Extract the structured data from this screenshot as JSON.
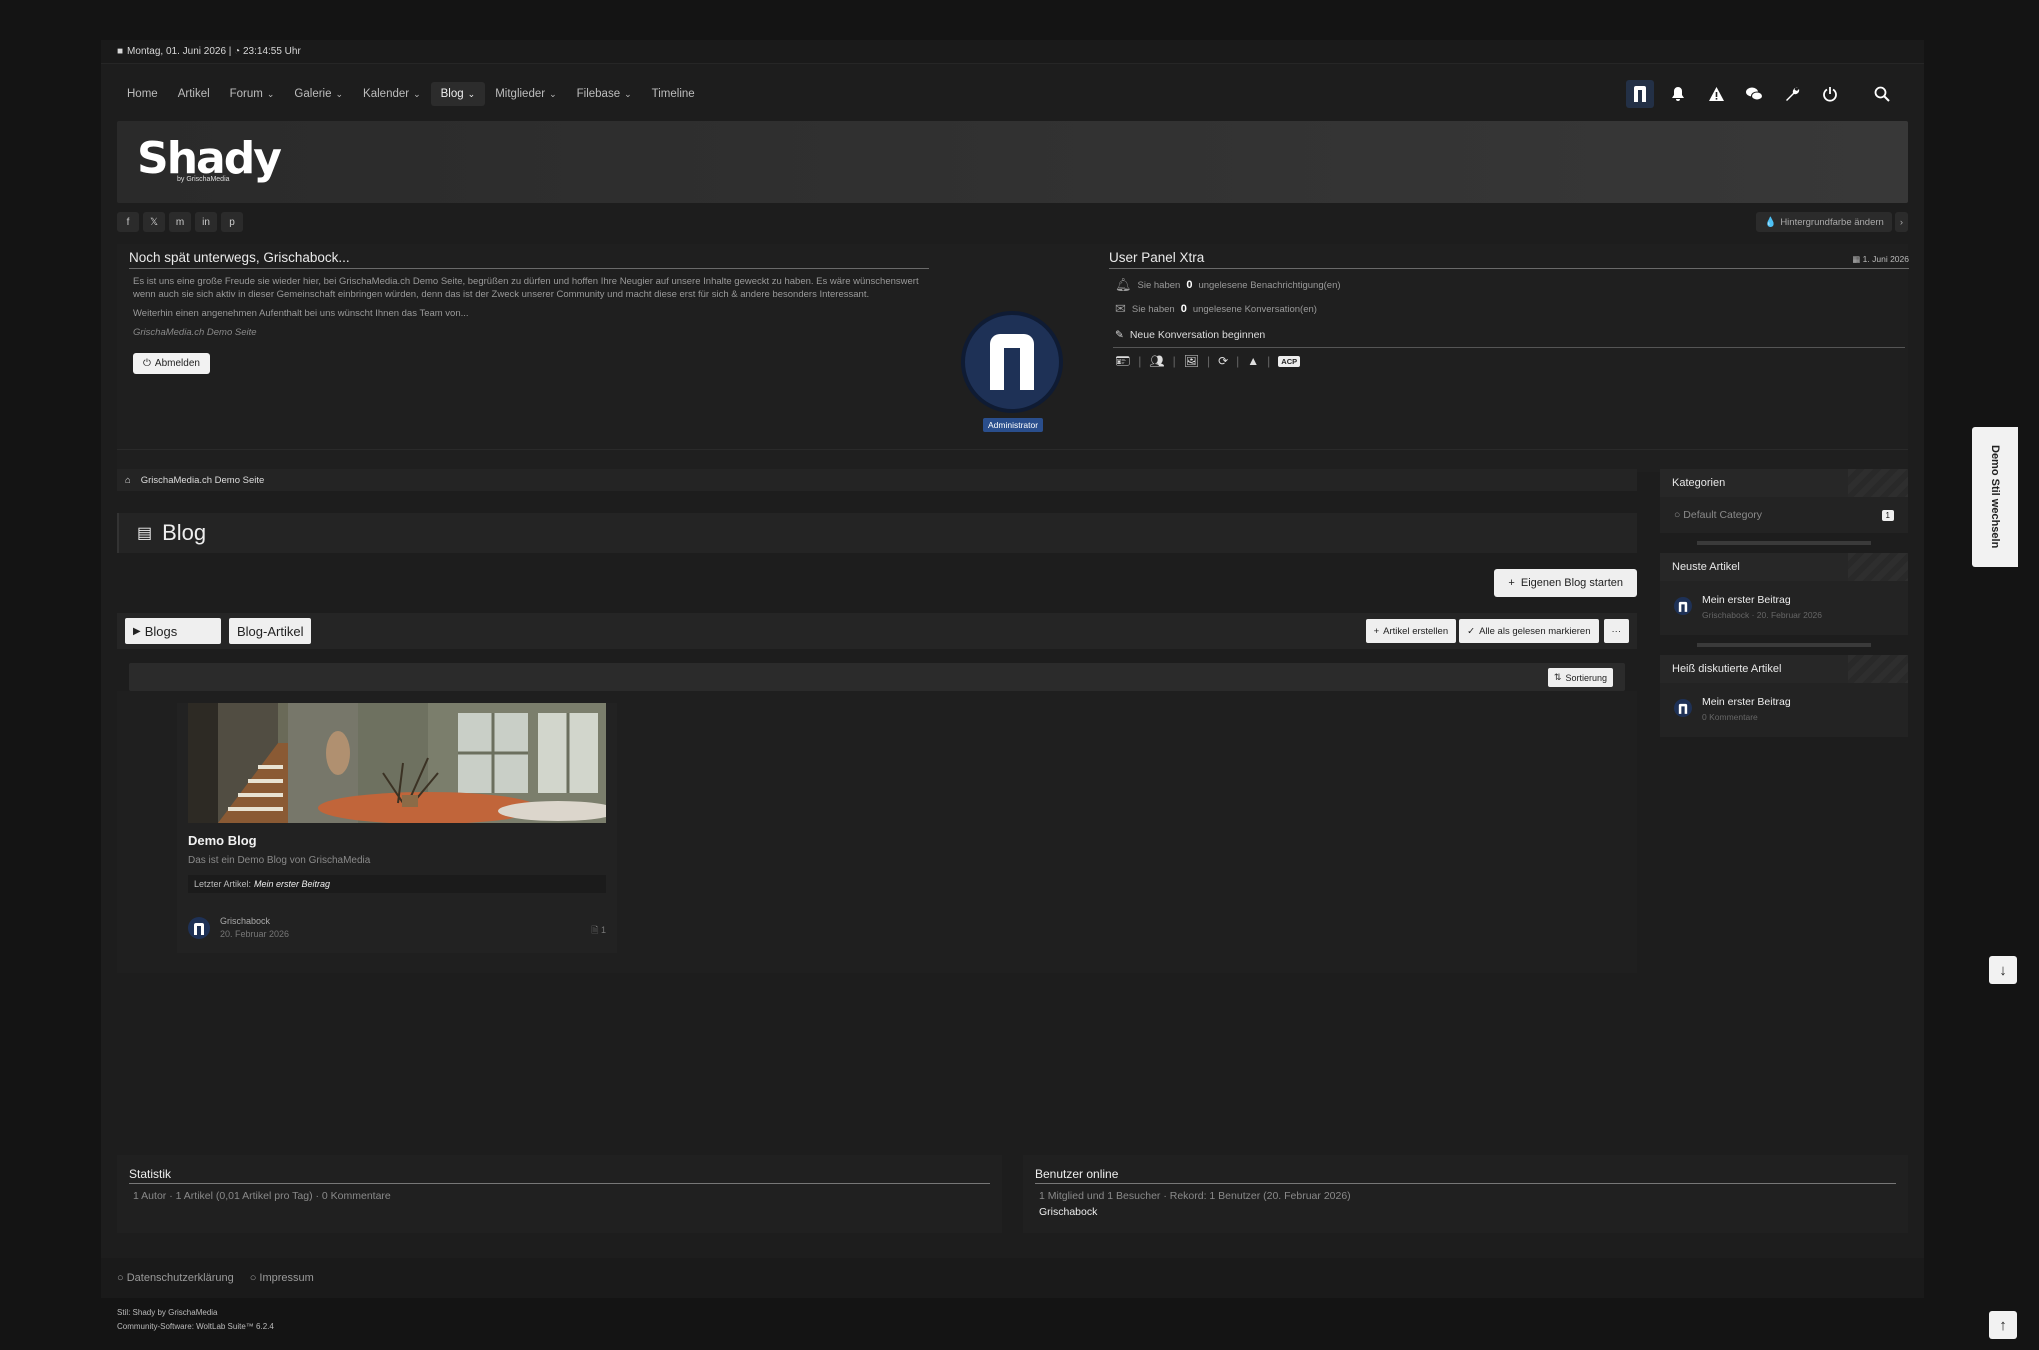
{
  "topbar": {
    "datetime": "Montag, 01. Juni 2026 | ◔ 23:14:55 Uhr"
  },
  "nav": {
    "items": [
      {
        "label": "Home",
        "dropdown": false
      },
      {
        "label": "Artikel",
        "dropdown": false
      },
      {
        "label": "Forum",
        "dropdown": true
      },
      {
        "label": "Galerie",
        "dropdown": true
      },
      {
        "label": "Kalender",
        "dropdown": true
      },
      {
        "label": "Blog",
        "dropdown": true,
        "active": true
      },
      {
        "label": "Mitglieder",
        "dropdown": true
      },
      {
        "label": "Filebase",
        "dropdown": true
      },
      {
        "label": "Timeline",
        "dropdown": false
      }
    ]
  },
  "brand": {
    "name": "Shady",
    "sub": "by GrischaMedia"
  },
  "header": {
    "bg_button": "Hintergrundfarbe ändern"
  },
  "welcome": {
    "title": "Noch spät unterwegs, Grischabock...",
    "p1": "Es ist uns eine große Freude sie wieder hier, bei GrischaMedia.ch Demo Seite, begrüßen zu dürfen und hoffen Ihre Neugier auf unsere Inhalte geweckt zu haben. Es wäre wünschenswert wenn auch sie sich aktiv in dieser Gemeinschaft einbringen würden, denn das ist der Zweck unserer Community und macht diese erst für sich & andere besonders Interessant.",
    "p2": "Weiterhin einen angenehmen Aufenthalt bei uns wünscht Ihnen das Team von...",
    "p3": "GrischaMedia.ch Demo Seite",
    "logout": "Abmelden"
  },
  "user": {
    "role": "Administrator"
  },
  "userpanel": {
    "title": "User Panel Xtra",
    "date": "1. Juni 2026",
    "notif_prefix": "Sie haben",
    "notif_count": "0",
    "notif_suffix": "ungelesene Benachrichtigung(en)",
    "conv_prefix": "Sie haben",
    "conv_count": "0",
    "conv_suffix": "ungelesene Konversation(en)",
    "new_conv": "Neue Konversation beginnen",
    "acp": "ACP"
  },
  "breadcrumb": {
    "label": "GrischaMedia.ch Demo Seite"
  },
  "page": {
    "title": "Blog",
    "start_blog": "Eigenen Blog starten"
  },
  "tabs": {
    "blogs": "Blogs",
    "articles": "Blog-Artikel",
    "create": "Artikel erstellen",
    "mark_read": "Alle als gelesen markieren",
    "more": "···",
    "sort": "Sortierung"
  },
  "blog_card": {
    "title": "Demo Blog",
    "desc": "Das ist ein Demo Blog von GrischaMedia",
    "last_label": "Letzter Artikel:",
    "last_title": "Mein erster Beitrag",
    "author": "Grischabock",
    "date": "20. Februar 2026",
    "count": "1"
  },
  "sidebar": {
    "categories": {
      "title": "Kategorien",
      "items": [
        {
          "label": "Default Category",
          "count": "1"
        }
      ]
    },
    "newest": {
      "title": "Neuste Artikel",
      "item": {
        "title": "Mein erster Beitrag",
        "meta": "Grischabock · 20. Februar 2026"
      }
    },
    "hot": {
      "title": "Heiß diskutierte Artikel",
      "item": {
        "title": "Mein erster Beitrag",
        "meta": "0 Kommentare"
      }
    }
  },
  "stats": {
    "title": "Statistik",
    "text": "1 Autor · 1 Artikel (0,01 Artikel pro Tag) · 0 Kommentare"
  },
  "online": {
    "title": "Benutzer online",
    "text": "1 Mitglied und 1 Besucher · Rekord: 1 Benutzer (20. Februar 2026)",
    "user": "Grischabock"
  },
  "footer": {
    "privacy": "Datenschutzerklärung",
    "imprint": "Impressum",
    "style": "Stil: Shady by GrischaMedia",
    "software": "Community-Software: WoltLab Suite™ 6.2.4"
  },
  "style_switch": "Demo Stil wechseln",
  "colors": {
    "bg": "#141414",
    "panel": "#1d1d1d",
    "accent": "#2a4e8c",
    "avatar": "#1e3156"
  }
}
